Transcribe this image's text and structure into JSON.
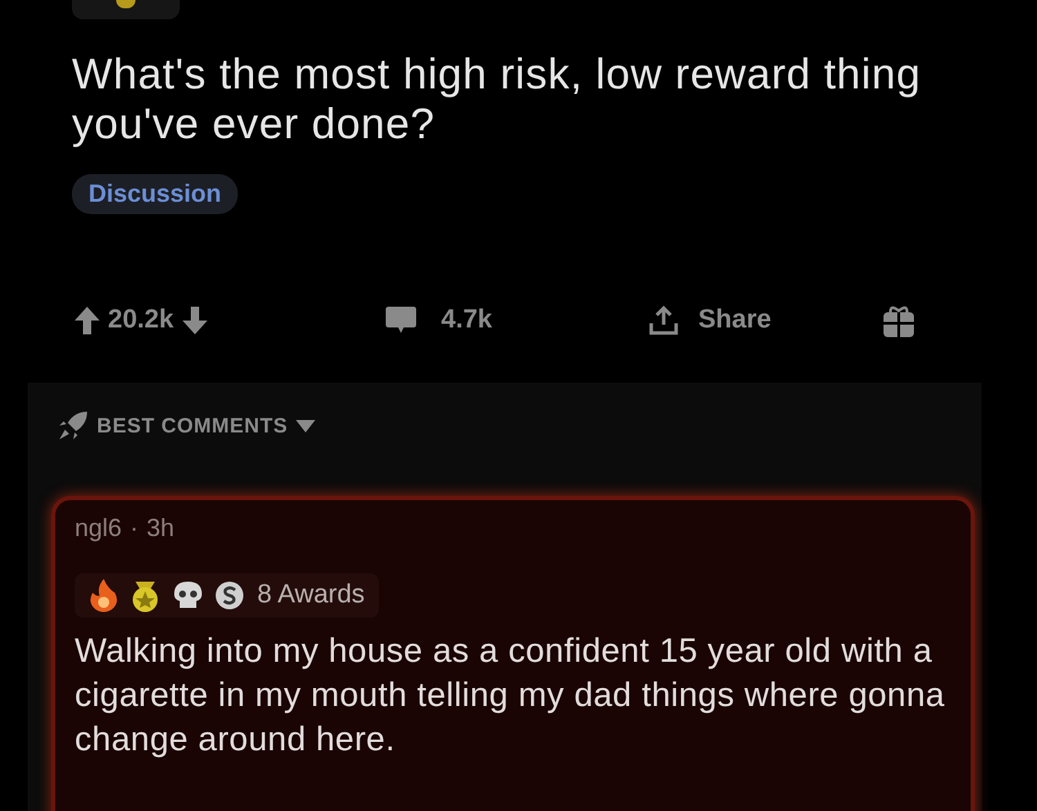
{
  "post": {
    "title": "What's the most high risk, low reward thing you've ever done?",
    "flair": "Discussion"
  },
  "actions": {
    "score": "20.2k",
    "comments": "4.7k",
    "share": "Share"
  },
  "comments_section": {
    "sort": "BEST COMMENTS",
    "comment": {
      "author": "ngl6",
      "separator": "·",
      "age": "3h",
      "awards": "8 Awards",
      "body": "Walking into my house as a confident 15 year old with a cigarette in my mouth telling my dad things where gonna change around here."
    }
  }
}
